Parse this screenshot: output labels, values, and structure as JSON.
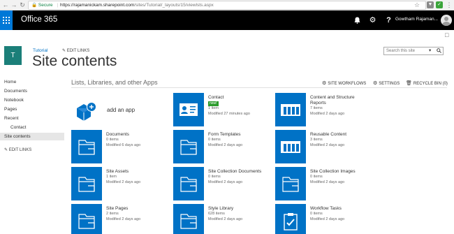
{
  "browser": {
    "secure_label": "Secure",
    "url_host": "https://rajamanickam.sharepoint.com",
    "url_path": "/sites/Tutorial/_layouts/15/viewlsts.aspx"
  },
  "suite": {
    "title": "Office 365",
    "user_name": "Gowtham Rajaman..."
  },
  "header": {
    "logo_letter": "T",
    "breadcrumb": "Tutorial",
    "edit_links": "EDIT LINKS",
    "title": "Site contents",
    "search_placeholder": "Search this site"
  },
  "left_nav": {
    "items": [
      "Home",
      "Documents",
      "Notebook",
      "Pages",
      "Recent",
      "Contact",
      "Site contents"
    ],
    "edit_links": "EDIT LINKS"
  },
  "section": {
    "title": "Lists, Libraries, and other Apps",
    "actions": {
      "site_workflows": "SITE WORKFLOWS",
      "settings": "SETTINGS",
      "recycle_bin": "RECYCLE BIN (0)"
    }
  },
  "add_app": {
    "label": "add an app"
  },
  "tiles": [
    {
      "title": "Contact",
      "badge": "new!",
      "count": "1 item",
      "modified": "Modified 27 minutes ago",
      "icon": "contact-card-icon"
    },
    {
      "title": "Content and Structure",
      "title2": "Reports",
      "count": "7 items",
      "modified": "Modified 2 days ago",
      "icon": "list-columns-icon"
    },
    {
      "title": "Documents",
      "count": "0 items",
      "modified": "Modified 6 days ago",
      "icon": "folder-icon"
    },
    {
      "title": "Form Templates",
      "count": "0 items",
      "modified": "Modified 2 days ago",
      "icon": "folder-icon"
    },
    {
      "title": "Reusable Content",
      "count": "3 items",
      "modified": "Modified 2 days ago",
      "icon": "list-columns-icon"
    },
    {
      "title": "Site Assets",
      "count": "1 item",
      "modified": "Modified 2 days ago",
      "icon": "folder-icon"
    },
    {
      "title": "Site Collection Documents",
      "count": "0 items",
      "modified": "Modified 2 days ago",
      "icon": "folder-icon"
    },
    {
      "title": "Site Collection Images",
      "count": "0 items",
      "modified": "Modified 2 days ago",
      "icon": "folder-icon"
    },
    {
      "title": "Site Pages",
      "count": "2 items",
      "modified": "Modified 2 days ago",
      "icon": "folder-icon"
    },
    {
      "title": "Style Library",
      "count": "628 items",
      "modified": "Modified 2 days ago",
      "icon": "folder-icon"
    },
    {
      "title": "Workflow Tasks",
      "count": "0 items",
      "modified": "Modified 2 days ago",
      "icon": "task-clipboard-icon"
    }
  ],
  "colors": {
    "tile_blue": "#0072c6",
    "suite_black": "#000000",
    "waffle_blue": "#0078d7",
    "site_logo": "#1b7f79",
    "badge_green": "#2c9b2c"
  }
}
